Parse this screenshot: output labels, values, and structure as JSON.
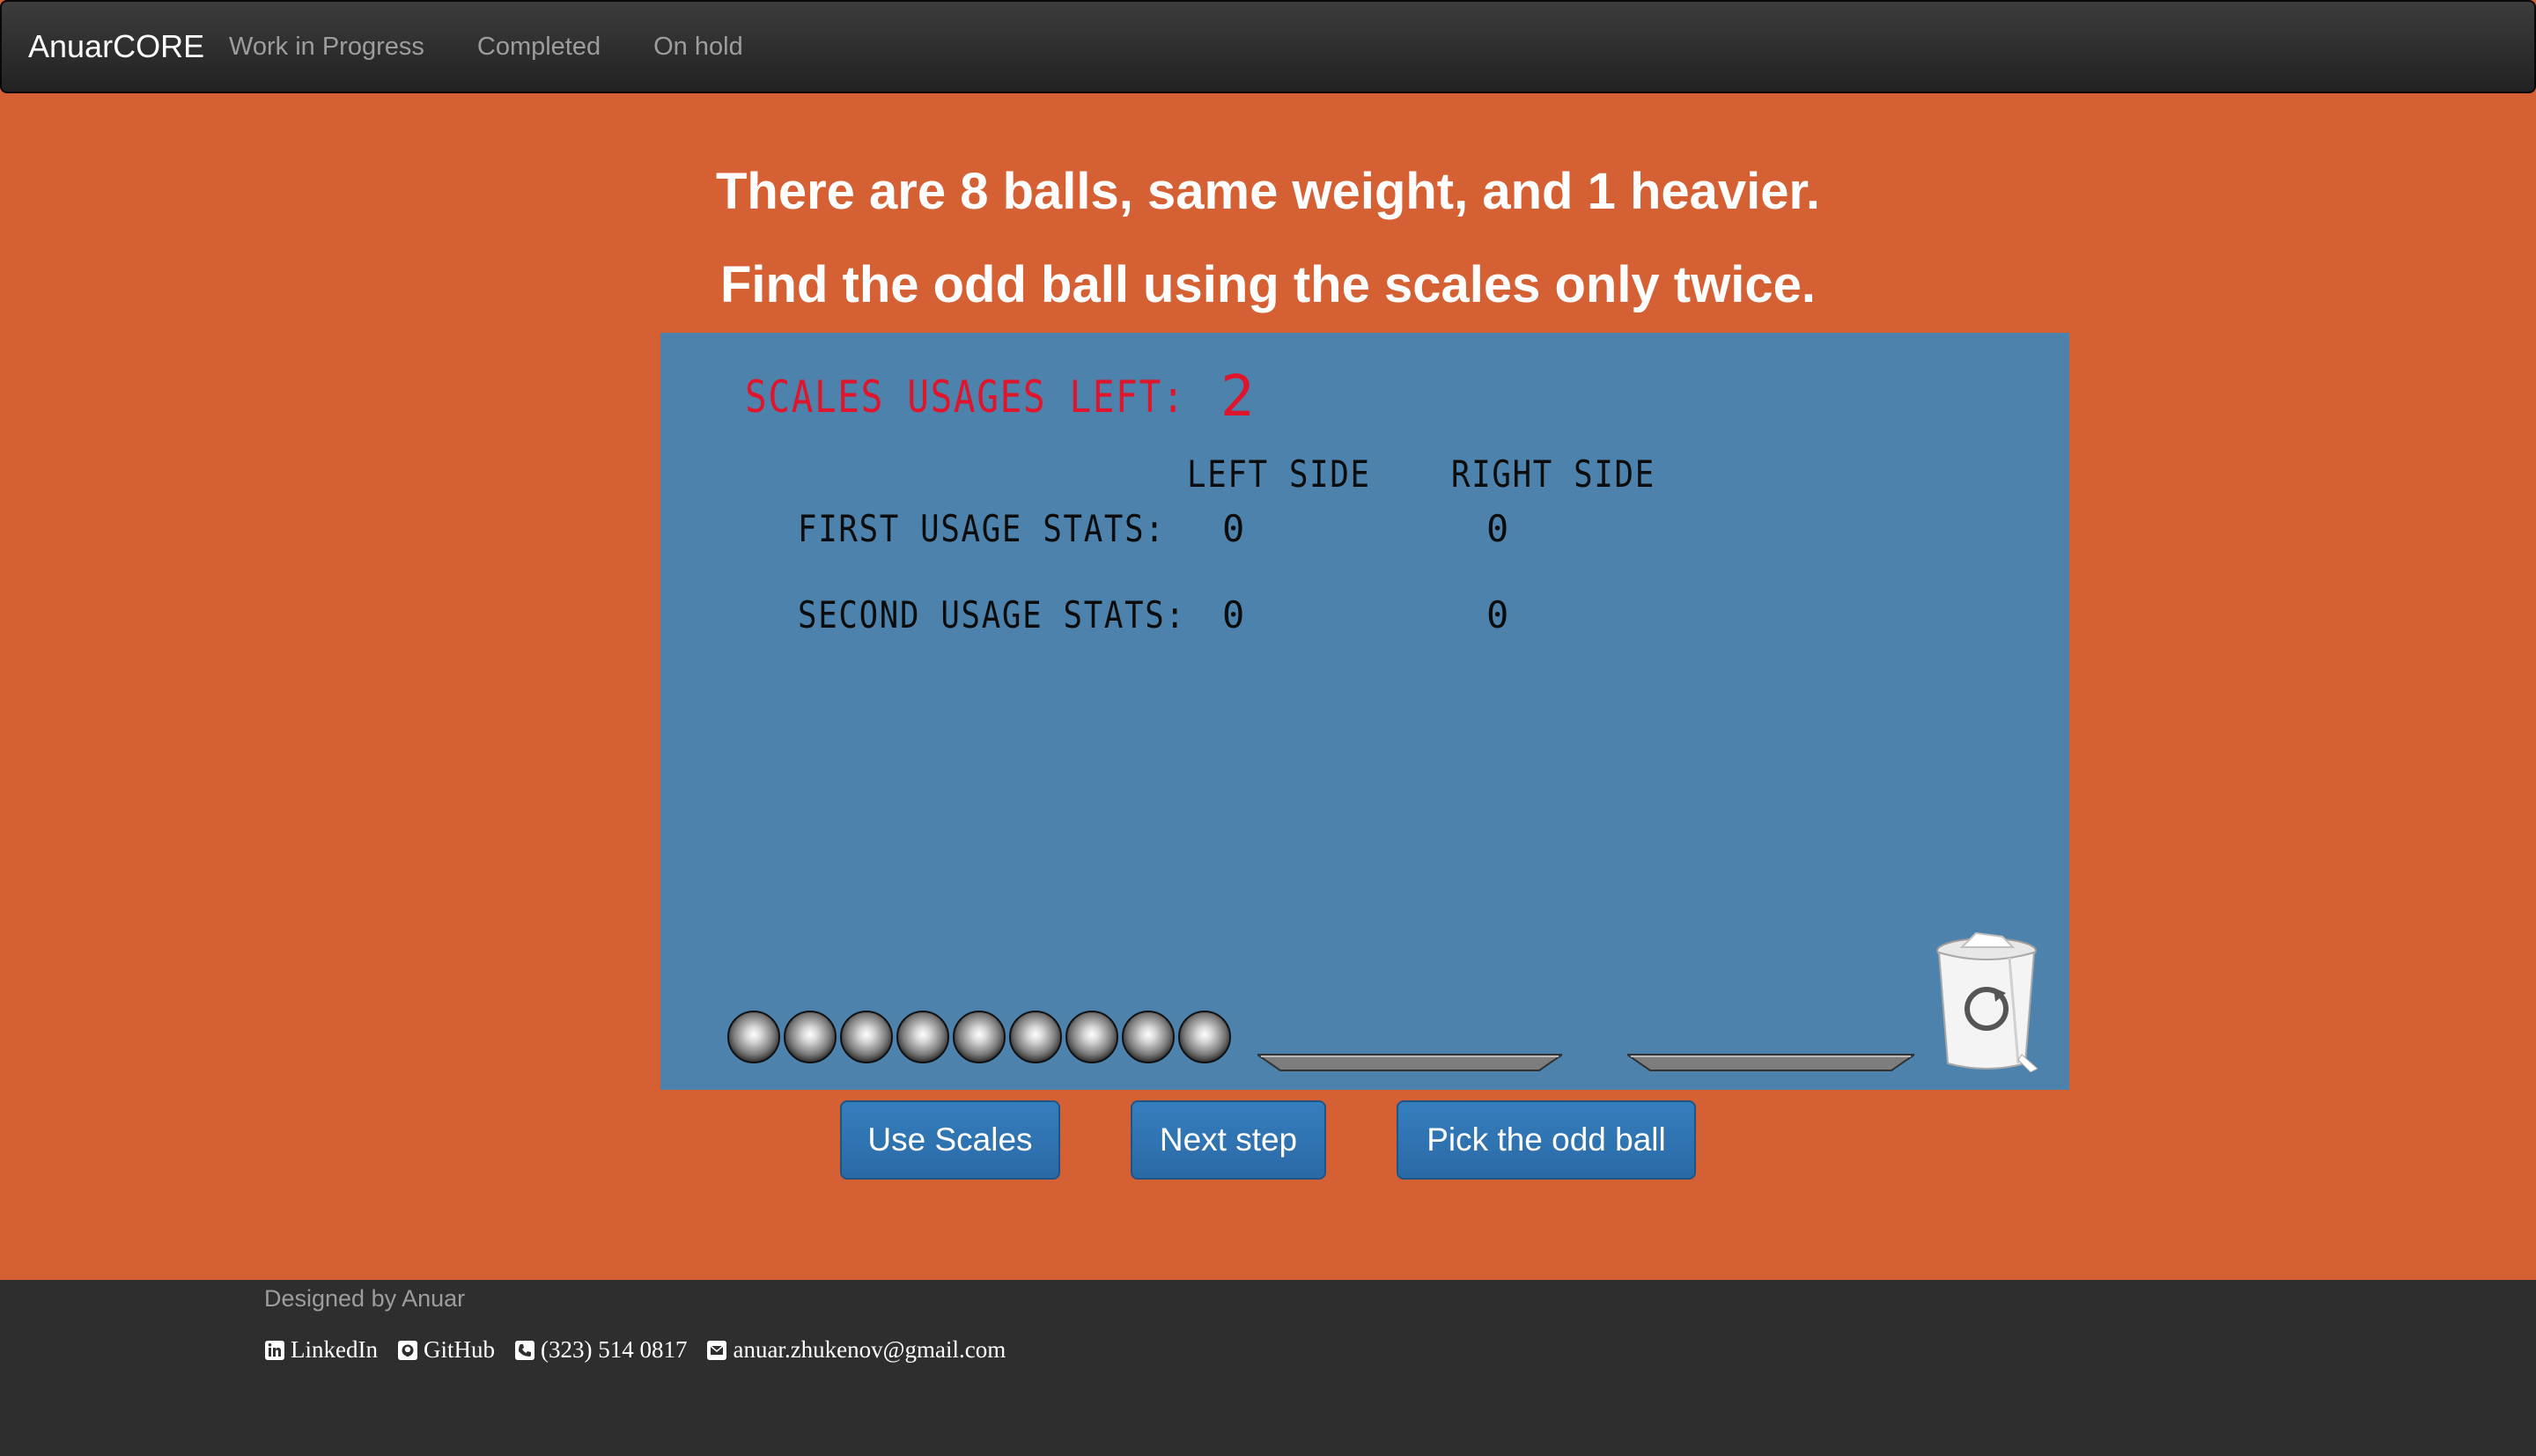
{
  "navbar": {
    "brand": "AnuarCORE",
    "links": [
      "Work in Progress",
      "Completed",
      "On hold"
    ]
  },
  "instructions": {
    "line1": "There are 8 balls, same weight, and 1 heavier.",
    "line2": "Find the odd ball using the scales only twice."
  },
  "game": {
    "usages_label": "SCALES USAGES LEFT:",
    "usages_left": "2",
    "col_left": "LEFT SIDE",
    "col_right": "RIGHT SIDE",
    "rows": [
      {
        "label": "FIRST USAGE STATS:",
        "left": "0",
        "right": "0"
      },
      {
        "label": "SECOND USAGE STATS:",
        "left": "0",
        "right": "0"
      }
    ],
    "ball_count": 9,
    "colors": {
      "panel": "#4c82ab",
      "accent": "#e0142a",
      "background": "#d46033"
    }
  },
  "buttons": {
    "use_scales": "Use Scales",
    "next_step": "Next step",
    "pick_odd": "Pick the odd ball"
  },
  "footer": {
    "designed_by": "Designed by Anuar",
    "linkedin": "LinkedIn",
    "github": "GitHub",
    "phone": "(323) 514 0817",
    "email": "anuar.zhukenov@gmail.com"
  }
}
